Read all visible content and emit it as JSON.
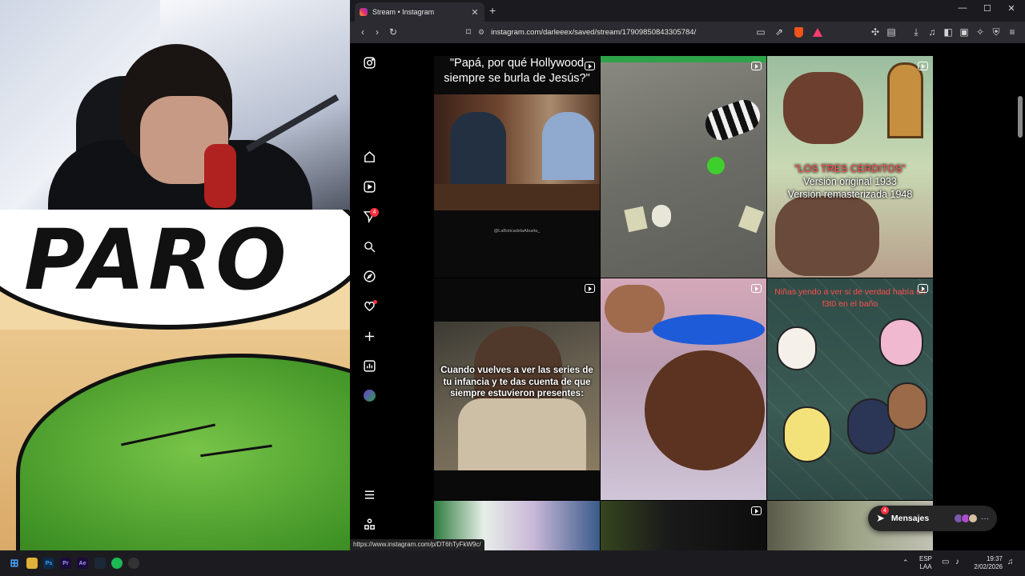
{
  "stream_overlay": {
    "meme_text": "PARO"
  },
  "browser": {
    "tab": {
      "title": "Stream • Instagram",
      "close_icon": "close-icon",
      "favicon": "instagram-icon"
    },
    "new_tab_icon": "plus-icon",
    "window_controls": {
      "minimize": "—",
      "maximize": "☐",
      "close": "✕"
    },
    "address": "instagram.com/darleeex/saved/stream/17909850843305784/",
    "status_url": "https://www.instagram.com/p/DT6hTyFkW9c/"
  },
  "instagram": {
    "nav": {
      "items": [
        "instagram-logo-icon",
        "home-icon",
        "reels-icon",
        "messages-icon",
        "search-icon",
        "explore-icon",
        "notifications-icon",
        "create-icon",
        "dashboard-icon",
        "profile-avatar",
        "menu-icon",
        "more-apps-icon"
      ],
      "messages_badge": "4"
    },
    "posts": [
      {
        "caption": "\"Papá, por qué Hollywood siempre se burla de Jesús?\"",
        "watermark": "@LaBoticadelaAbuela_",
        "reel": true
      },
      {
        "caption": "",
        "reel": true
      },
      {
        "caption_red": "\"LOS TRES CERDITOS\"",
        "line1": "Versión original 1933",
        "line2": "Versión remasterizada 1948",
        "reel": true
      },
      {
        "caption": "Cuando vuelves a ver las series de tu infancia y te das cuenta de que siempre estuvieron presentes:",
        "reel": true
      },
      {
        "caption": "",
        "reel": true
      },
      {
        "caption": "Niñas yendo a ver si de verdad había un f3t0 en el baño",
        "reel": true
      },
      {
        "caption": "",
        "reel": false
      },
      {
        "caption": "",
        "reel": true
      },
      {
        "caption": "",
        "reel": false
      }
    ],
    "messages_button": {
      "label": "Mensajes",
      "badge": "4"
    }
  },
  "taskbar": {
    "lang_top": "ESP",
    "lang_bottom": "LAA",
    "time": "19:37",
    "date": "2/02/2026",
    "apps": [
      "windows-start-icon",
      "file-explorer-icon",
      "photoshop-icon",
      "premiere-icon",
      "after-effects-icon",
      "steam-icon",
      "spotify-icon",
      "obs-icon"
    ],
    "app_labels": {
      "ps": "Ps",
      "pr": "Pr",
      "ae": "Ae"
    }
  },
  "colors": {
    "instagram_red": "#ff3040",
    "brave_orange": "#f0531c",
    "bg": "#000000"
  }
}
